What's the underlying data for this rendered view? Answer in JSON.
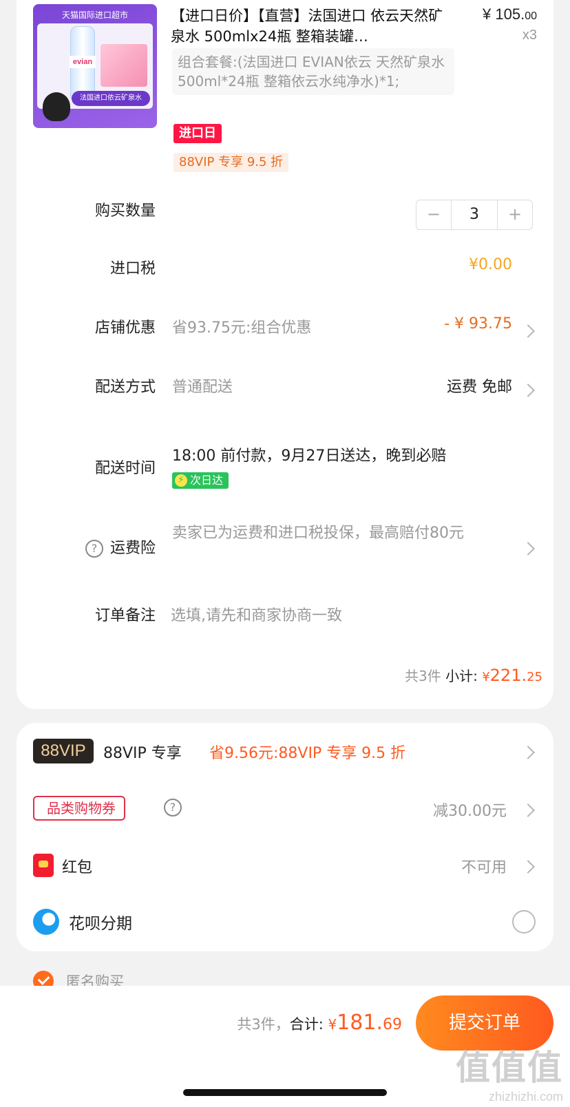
{
  "product": {
    "thumb_banner": "天猫国际进口超市",
    "thumb_brand": "evian",
    "thumb_caption": "法国进口依云矿泉水",
    "title": "【进口日价】【直营】法国进口 依云天然矿泉水 500mlx24瓶 整箱装罐…",
    "price_int": "¥ 105.",
    "price_dec": "00",
    "quantity_label": "x3",
    "combo": "组合套餐:(法国进口 EVIAN依云 天然矿泉水 500ml*24瓶 整箱依云水纯净水)*1;",
    "tag_import": "进口日",
    "tag_vip": "88VIP 专享 9.5 折"
  },
  "quantity": {
    "label": "购买数量",
    "value": "3",
    "minus": "−",
    "plus": "+"
  },
  "import_tax": {
    "label": "进口税",
    "value": "¥0.00"
  },
  "store_discount": {
    "label": "店铺优惠",
    "detail": "省93.75元:组合优惠",
    "value": "- ¥ 93.75"
  },
  "delivery_method": {
    "label": "配送方式",
    "detail": "普通配送",
    "value": "运费 免邮"
  },
  "delivery_time": {
    "label": "配送时间",
    "detail": "18:00 前付款，9月27日送达，晚到必赔",
    "badge": "次日达"
  },
  "shipping_insurance": {
    "label": "运费险",
    "detail": "卖家已为运费和进口税投保，最高赔付80元"
  },
  "order_note": {
    "label": "订单备注",
    "placeholder": "选填,请先和商家协商一致"
  },
  "subtotal": {
    "count": "共3件",
    "label": "小计:",
    "currency": "¥",
    "int": "221.",
    "dec": "25"
  },
  "vip": {
    "logo": "88VIP",
    "label": "88VIP 专享",
    "detail": "省9.56元:88VIP 专享 9.5 折"
  },
  "coupon": {
    "label": "品类购物券",
    "value": "减30.00元"
  },
  "red_packet": {
    "label": "红包",
    "value": "不可用"
  },
  "huabei": {
    "label": "花呗分期"
  },
  "anonymous": {
    "label": "匿名购买"
  },
  "footer": {
    "count": "共3件，",
    "total_label": "合计:",
    "currency": "¥",
    "total_int": "181.",
    "total_dec": "69",
    "submit": "提交订单"
  },
  "watermark": {
    "big": "值值值",
    "small": "zhizhizhi.com"
  },
  "colors": {
    "accent": "#ff5a1f",
    "price_orange": "#e56d1f",
    "tax_yellow": "#f5a623",
    "green_badge": "#2ac35b"
  }
}
